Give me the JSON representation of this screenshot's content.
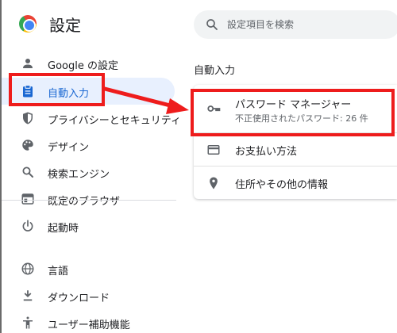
{
  "header": {
    "title": "設定",
    "search_placeholder": "設定項目を検索"
  },
  "sidebar": {
    "items": [
      {
        "label": "Google の設定",
        "icon": "person-icon"
      },
      {
        "label": "自動入力",
        "icon": "clipboard-icon",
        "active": true
      },
      {
        "label": "プライバシーとセキュリティ",
        "icon": "shield-icon"
      },
      {
        "label": "デザイン",
        "icon": "palette-icon"
      },
      {
        "label": "検索エンジン",
        "icon": "search-icon"
      },
      {
        "label": "既定のブラウザ",
        "icon": "browser-icon"
      },
      {
        "label": "起動時",
        "icon": "power-icon"
      },
      {
        "label": "言語",
        "icon": "globe-icon"
      },
      {
        "label": "ダウンロード",
        "icon": "download-icon"
      },
      {
        "label": "ユーザー補助機能",
        "icon": "accessibility-icon"
      }
    ]
  },
  "main": {
    "section_title": "自動入力",
    "rows": [
      {
        "title": "パスワード マネージャー",
        "subtitle": "不正使用されたパスワード: 26 件",
        "icon": "key-icon"
      },
      {
        "title": "お支払い方法",
        "icon": "credit-card-icon"
      },
      {
        "title": "住所やその他の情報",
        "icon": "location-pin-icon"
      }
    ]
  },
  "colors": {
    "accent": "#1967d2",
    "active_bg": "#e8f0fe",
    "annotation_red": "#ee1c1c",
    "icon_gray": "#5f6368"
  }
}
